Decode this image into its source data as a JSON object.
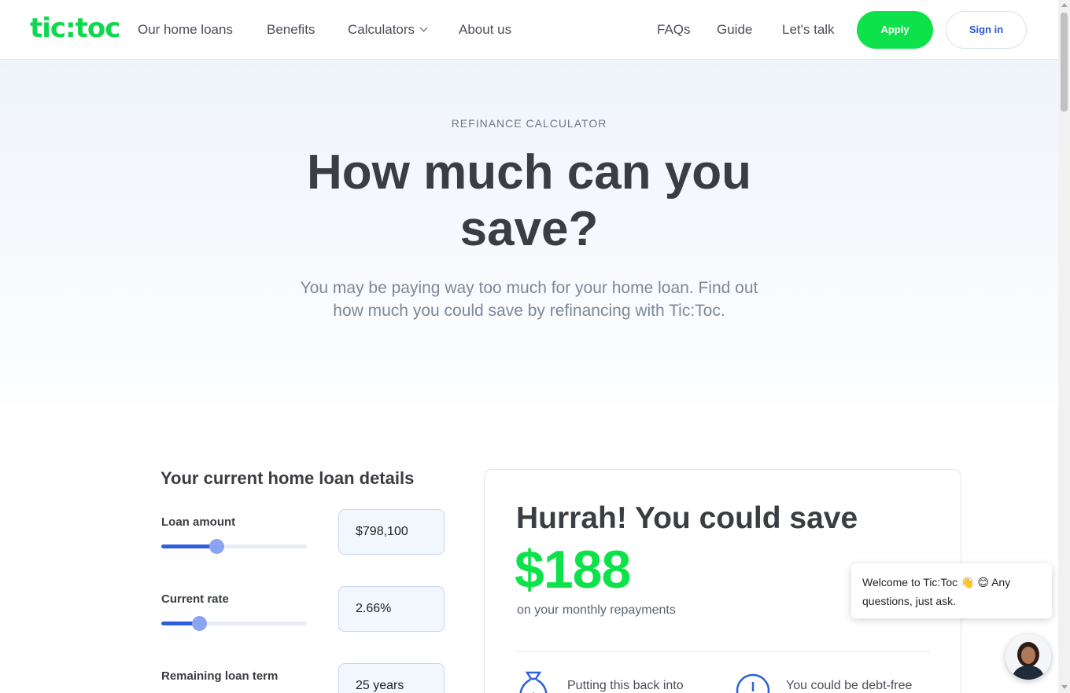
{
  "header": {
    "logo": "tic:toc",
    "nav": [
      "Our home loans",
      "Benefits",
      "Calculators",
      "About us"
    ],
    "nav_right": [
      "FAQs",
      "Guide",
      "Let's talk"
    ],
    "apply_label": "Apply",
    "signin_label": "Sign in"
  },
  "hero": {
    "eyebrow": "REFINANCE CALCULATOR",
    "title_line1": "How much can you",
    "title_line2": "save?",
    "subtitle": "You may be paying way too much for your home loan. Find out how much you could save by refinancing with Tic:Toc."
  },
  "form": {
    "title": "Your current home loan details",
    "fields": [
      {
        "label": "Loan amount",
        "value": "$798,100",
        "fill_fraction": 0.38
      },
      {
        "label": "Current rate",
        "value": "2.66%",
        "fill_fraction": 0.26
      },
      {
        "label": "Remaining loan term",
        "value": "25 years"
      }
    ]
  },
  "result": {
    "heading": "Hurrah! You could save",
    "amount": "$188",
    "subtext": "on your monthly repayments",
    "benefit1": "Putting this back into",
    "benefit2": "You could be debt-free"
  },
  "chat": {
    "greeting": "Welcome to Tic:Toc",
    "emoji1": "👋",
    "emoji2": "😊",
    "message": "Any questions, just ask."
  },
  "colors": {
    "brand_green": "#0ee24b",
    "accent_blue": "#2e5fe0",
    "text_dark": "#3a3d42"
  }
}
